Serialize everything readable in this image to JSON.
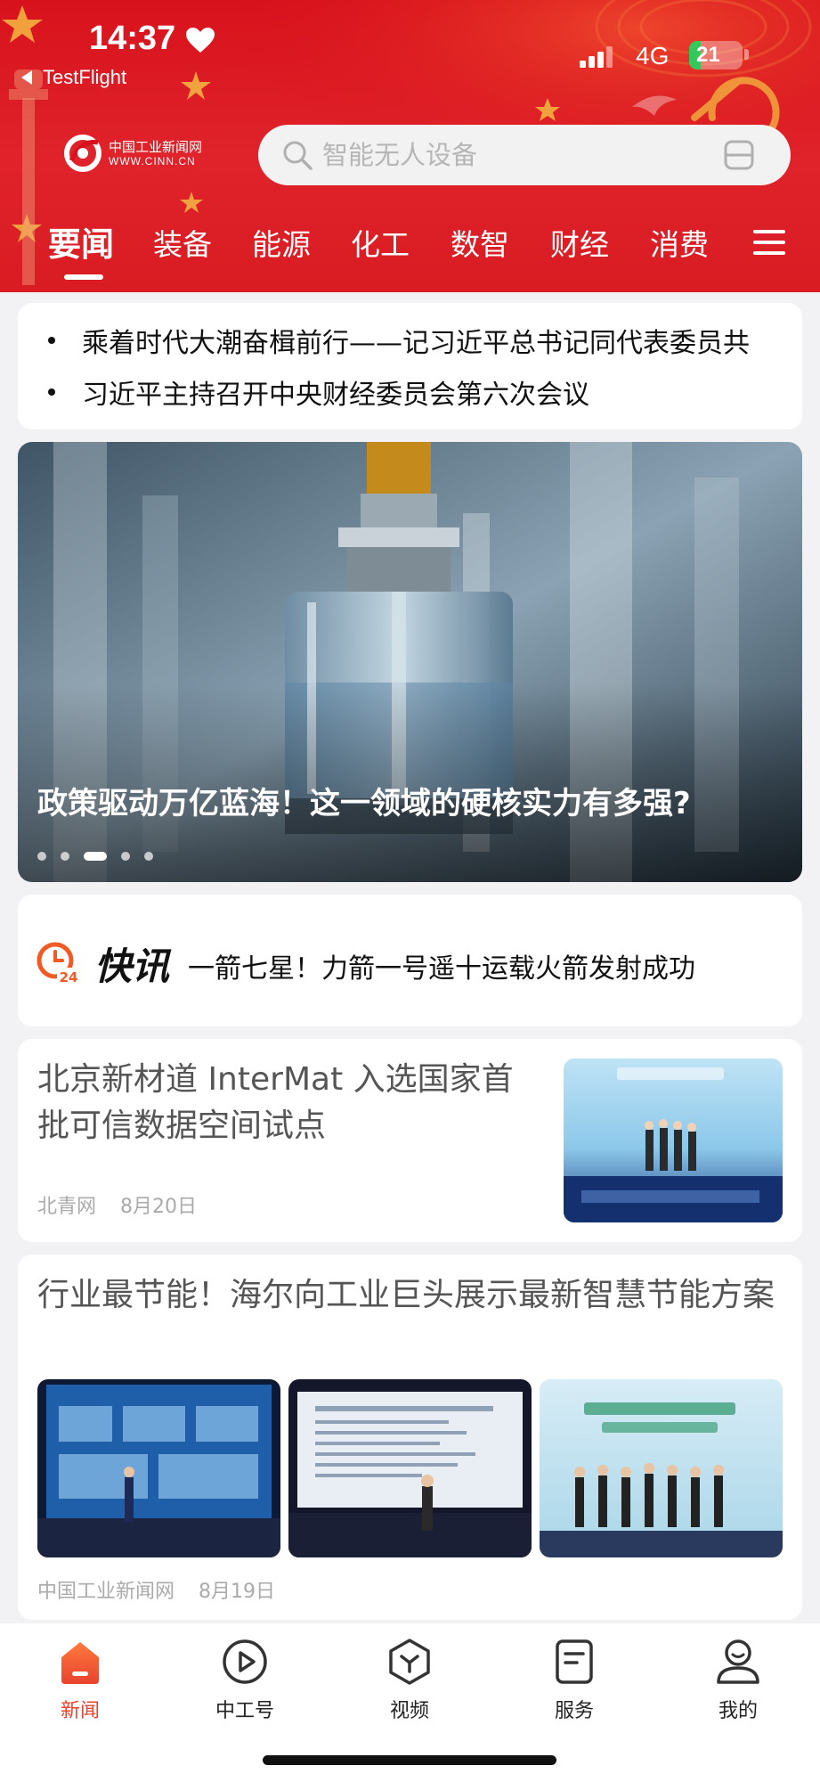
{
  "status_bar": {
    "time": "14:37",
    "back_app": "TestFlight",
    "network": "4G",
    "battery": "21",
    "battery_level": 0.21
  },
  "header": {
    "logo_cn": "中国工业新闻网",
    "logo_en": "WWW.CINN.CN",
    "search_placeholder": "智能无人设备",
    "tabs": [
      "要闻",
      "装备",
      "能源",
      "化工",
      "数智",
      "财经",
      "消费"
    ],
    "active_tab": "要闻"
  },
  "headlines": [
    "乘着时代大潮奋楫前行——记习近平总书记同代表委员共",
    "习近平主持召开中央财经委员会第六次会议"
  ],
  "banner": {
    "title": "政策驱动万亿蓝海！这一领域的硬核实力有多强?",
    "slide_count": 5,
    "active_slide": 3
  },
  "flash": {
    "badge_number": "24",
    "label": "快讯",
    "text": "一箭七星！力箭一号遥十运载火箭发射成功"
  },
  "articles": [
    {
      "title": "北京新材道 InterMat 入选国家首批可信数据空间试点",
      "source": "北青网",
      "date": "8月20日"
    },
    {
      "title": "行业最节能！海尔向工业巨头展示最新智慧节能方案",
      "source": "中国工业新闻网",
      "date": "8月19日"
    }
  ],
  "bottom_nav": [
    {
      "label": "新闻",
      "icon": "home-icon",
      "active": true
    },
    {
      "label": "中工号",
      "icon": "play-circle-icon",
      "active": false
    },
    {
      "label": "视频",
      "icon": "video-hexagon-icon",
      "active": false
    },
    {
      "label": "服务",
      "icon": "document-icon",
      "active": false
    },
    {
      "label": "我的",
      "icon": "user-icon",
      "active": false
    }
  ],
  "colors": {
    "brand_red": "#d8121c",
    "accent_orange": "#f15a24",
    "nav_active": "#e8432f",
    "battery_green": "#34c759"
  }
}
